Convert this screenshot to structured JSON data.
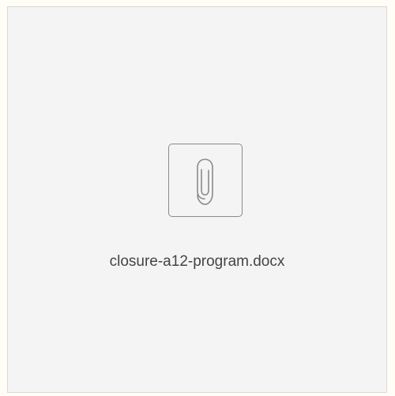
{
  "attachment": {
    "file_name": "closure-a12-program.docx",
    "icon": "paperclip-icon"
  },
  "colors": {
    "page_background": "#fffdf5",
    "card_background": "#f4f4f4",
    "icon_stroke": "#8a8a8a",
    "text": "#444444"
  }
}
